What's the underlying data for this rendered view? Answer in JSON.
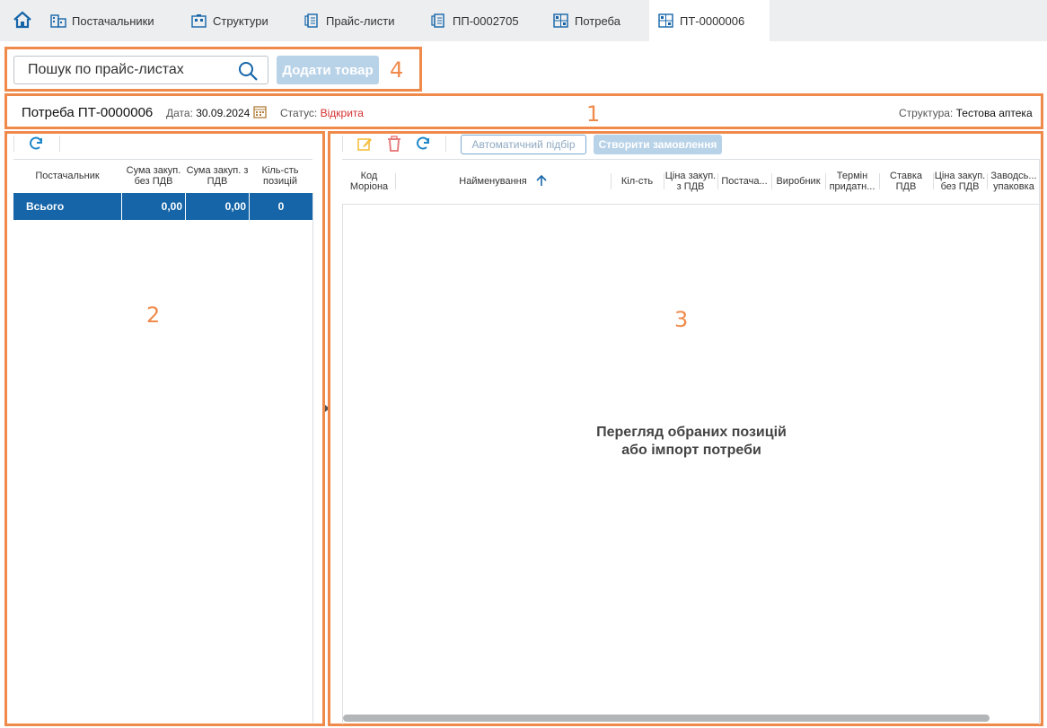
{
  "tabs": [
    {
      "label": "Постачальники",
      "icon": "building-icon"
    },
    {
      "label": "Структури",
      "icon": "structure-icon"
    },
    {
      "label": "Прайс-листи",
      "icon": "pricelist-icon"
    },
    {
      "label": "ПП-0002705",
      "icon": "pricelist-icon"
    },
    {
      "label": "Потреба",
      "icon": "grid-doc-icon"
    },
    {
      "label": "ПТ-0000006",
      "icon": "grid-doc-icon"
    }
  ],
  "search": {
    "placeholder": "Пошук по прайс-листах"
  },
  "add_button": "Додати товар",
  "annotations": {
    "a1": "1",
    "a2": "2",
    "a3": "3",
    "a4": "4"
  },
  "header": {
    "title": "Потреба ПТ-0000006",
    "date_label": "Дата:",
    "date": "30.09.2024",
    "status_label": "Статус:",
    "status": "Відкрита",
    "structure_label": "Структура:",
    "structure": "Тестова аптека"
  },
  "left_table": {
    "columns": [
      "Постачальник",
      "Сума закуп. без ПДВ",
      "Сума закуп. з ПДВ",
      "Кіль-сть позицій"
    ],
    "total_row": {
      "name": "Всього",
      "sum_no_vat": "0,00",
      "sum_vat": "0,00",
      "count": "0"
    }
  },
  "right_toolbar": {
    "auto_select": "Автоматичний підбір",
    "create_order": "Створити замовлення"
  },
  "right_table": {
    "columns": [
      "Код Моріона",
      "Найменування",
      "Кіл-сть",
      "Ціна закуп. з ПДВ",
      "Постача...",
      "Виробник",
      "Термін придатн...",
      "Ставка ПДВ",
      "Ціна закуп. без ПДВ",
      "Заводсь... упаковка"
    ]
  },
  "empty_state": {
    "line1": "Перегляд обраних позицій",
    "line2": "або імпорт потреби"
  },
  "colors": {
    "accent": "#1565a8",
    "annotation": "#f08a4b",
    "status": "#d32f2f"
  }
}
